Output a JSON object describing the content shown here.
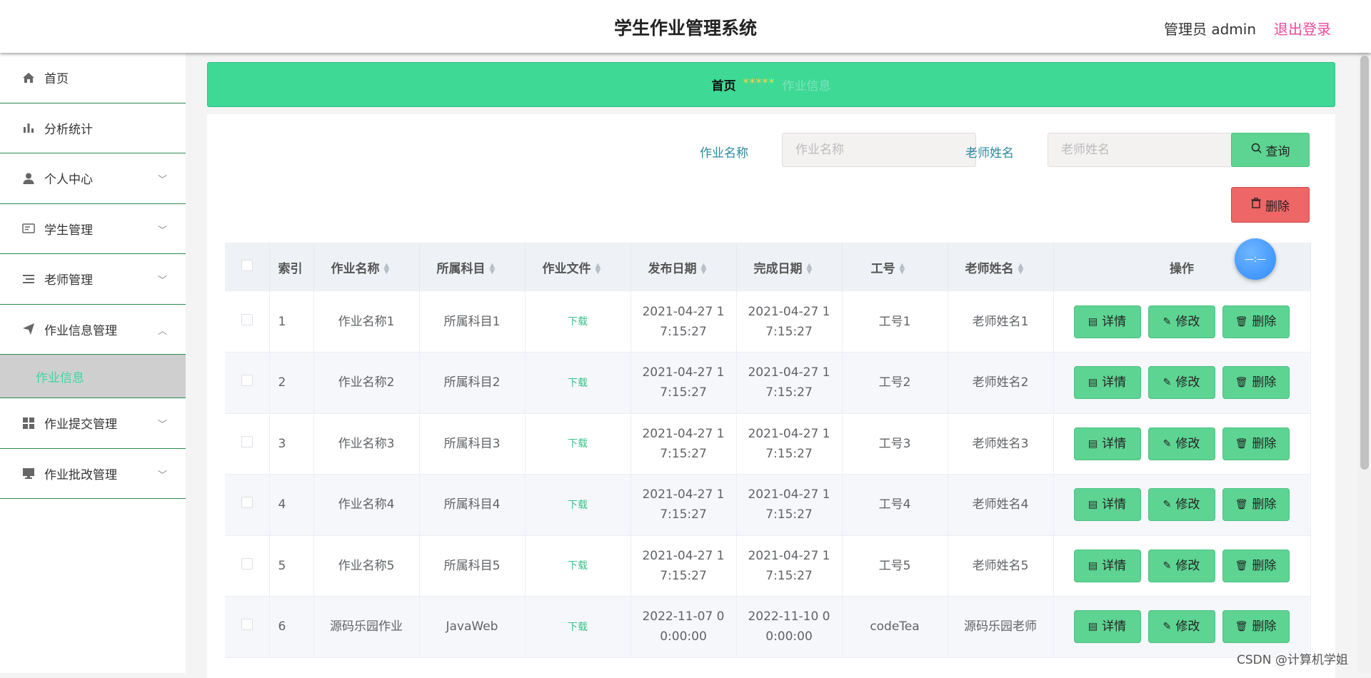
{
  "header": {
    "title": "学生作业管理系统",
    "user": "管理员 admin",
    "logout": "退出登录"
  },
  "sidebar": {
    "items": [
      {
        "label": "首页",
        "icon": "home-icon"
      },
      {
        "label": "分析统计",
        "icon": "bar-chart-icon"
      },
      {
        "label": "个人中心",
        "icon": "user-icon",
        "chevron": "down"
      },
      {
        "label": "学生管理",
        "icon": "id-card-icon",
        "chevron": "down"
      },
      {
        "label": "老师管理",
        "icon": "list-icon",
        "chevron": "down"
      },
      {
        "label": "作业信息管理",
        "icon": "send-icon",
        "chevron": "up",
        "active": true
      },
      {
        "label": "作业提交管理",
        "icon": "grid-icon",
        "chevron": "down"
      },
      {
        "label": "作业批改管理",
        "icon": "monitor-icon",
        "chevron": "down"
      }
    ],
    "subitem": "作业信息"
  },
  "breadcrumb": {
    "home": "首页",
    "sep": "*****",
    "current": "作业信息"
  },
  "search": {
    "name_label": "作业名称",
    "name_placeholder": "作业名称",
    "teacher_label": "老师姓名",
    "teacher_placeholder": "老师姓名",
    "query": "查询",
    "delete": "删除"
  },
  "table": {
    "headers": [
      "索引",
      "作业名称",
      "所属科目",
      "作业文件",
      "发布日期",
      "完成日期",
      "工号",
      "老师姓名",
      "操作"
    ],
    "rows": [
      {
        "idx": "1",
        "name": "作业名称1",
        "subject": "所属科目1",
        "file": "下载",
        "pub1": "2021-04-27 1",
        "pub2": "7:15:27",
        "done1": "2021-04-27 1",
        "done2": "7:15:27",
        "no": "工号1",
        "teacher": "老师姓名1"
      },
      {
        "idx": "2",
        "name": "作业名称2",
        "subject": "所属科目2",
        "file": "下载",
        "pub1": "2021-04-27 1",
        "pub2": "7:15:27",
        "done1": "2021-04-27 1",
        "done2": "7:15:27",
        "no": "工号2",
        "teacher": "老师姓名2"
      },
      {
        "idx": "3",
        "name": "作业名称3",
        "subject": "所属科目3",
        "file": "下载",
        "pub1": "2021-04-27 1",
        "pub2": "7:15:27",
        "done1": "2021-04-27 1",
        "done2": "7:15:27",
        "no": "工号3",
        "teacher": "老师姓名3"
      },
      {
        "idx": "4",
        "name": "作业名称4",
        "subject": "所属科目4",
        "file": "下载",
        "pub1": "2021-04-27 1",
        "pub2": "7:15:27",
        "done1": "2021-04-27 1",
        "done2": "7:15:27",
        "no": "工号4",
        "teacher": "老师姓名4"
      },
      {
        "idx": "5",
        "name": "作业名称5",
        "subject": "所属科目5",
        "file": "下载",
        "pub1": "2021-04-27 1",
        "pub2": "7:15:27",
        "done1": "2021-04-27 1",
        "done2": "7:15:27",
        "no": "工号5",
        "teacher": "老师姓名5"
      },
      {
        "idx": "6",
        "name": "源码乐园作业",
        "subject": "JavaWeb",
        "file": "下载",
        "pub1": "2022-11-07 0",
        "pub2": "0:00:00",
        "done1": "2022-11-10 0",
        "done2": "0:00:00",
        "no": "codeTea",
        "teacher": "源码乐园老师"
      }
    ],
    "actions": {
      "detail": "详情",
      "edit": "修改",
      "delete": "删除"
    }
  },
  "fab": {
    "label": "—:—"
  },
  "watermark": "CSDN @计算机学姐",
  "colors": {
    "accent": "#3ed994",
    "danger": "#ee6666",
    "logout": "#ea4a9b",
    "label": "#2b8aa0"
  }
}
